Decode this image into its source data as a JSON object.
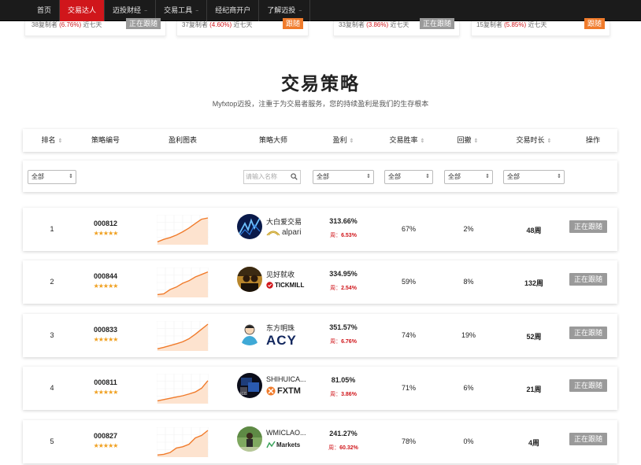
{
  "nav": {
    "items": [
      {
        "label": "首页",
        "caret": false,
        "active": false
      },
      {
        "label": "交易达人",
        "caret": false,
        "active": true
      },
      {
        "label": "迈投财经",
        "caret": true,
        "active": false
      },
      {
        "label": "交易工具",
        "caret": true,
        "active": false
      },
      {
        "label": "经纪商开户",
        "caret": false,
        "active": false
      },
      {
        "label": "了解迈投",
        "caret": true,
        "active": false
      }
    ]
  },
  "top_cards": [
    {
      "copiers": "38复制者",
      "pct": "(6.76%)",
      "period": "近七天",
      "button": "正在跟随",
      "button_style": "gray"
    },
    {
      "copiers": "37复制者",
      "pct": "(4.60%)",
      "period": "近七天",
      "button": "跟随",
      "button_style": "orange"
    },
    {
      "copiers": "33复制者",
      "pct": "(3.86%)",
      "period": "近七天",
      "button": "正在跟随",
      "button_style": "gray"
    },
    {
      "copiers": "15复制者",
      "pct": "(5.85%)",
      "period": "近七天",
      "button": "跟随",
      "button_style": "orange"
    }
  ],
  "section": {
    "title": "交易策略",
    "subtitle": "Myfxtop迈投，注重于为交易者服务，您的持续盈利是我们的生存根本"
  },
  "table": {
    "headers": {
      "rank": "排名",
      "code": "策略编号",
      "chart": "盈利图表",
      "master": "策略大师",
      "profit": "盈利",
      "winrate": "交易胜率",
      "drawdown": "回撤",
      "duration": "交易时长",
      "action": "操作"
    },
    "filters": {
      "all": "全部",
      "arrow": "⇕",
      "search_placeholder": "请输入名称"
    },
    "week_prefix": "周：",
    "rows": [
      {
        "rank": "1",
        "code": "000812",
        "stars": "★★★★★",
        "master": "大白爱交易",
        "broker": "alpari",
        "profit": "313.66%",
        "week": "6.53%",
        "winrate": "67%",
        "drawdown": "2%",
        "duration": "48周",
        "action": "正在跟随",
        "curve": [
          0.05,
          0.15,
          0.22,
          0.32,
          0.45,
          0.6,
          0.78,
          0.95,
          1.0
        ]
      },
      {
        "rank": "2",
        "code": "000844",
        "stars": "★★★★★",
        "master": "见好就收",
        "broker": "TICKMILL",
        "profit": "334.95%",
        "week": "2.54%",
        "winrate": "59%",
        "drawdown": "8%",
        "duration": "132周",
        "action": "正在跟随",
        "curve": [
          0.05,
          0.08,
          0.25,
          0.35,
          0.5,
          0.6,
          0.75,
          0.85,
          0.95
        ]
      },
      {
        "rank": "3",
        "code": "000833",
        "stars": "★★★★★",
        "master": "东方明珠",
        "broker": "ACY",
        "profit": "351.57%",
        "week": "6.76%",
        "winrate": "74%",
        "drawdown": "19%",
        "duration": "52周",
        "action": "正在跟随",
        "curve": [
          0.02,
          0.08,
          0.15,
          0.22,
          0.3,
          0.42,
          0.6,
          0.8,
          1.0
        ]
      },
      {
        "rank": "4",
        "code": "000811",
        "stars": "★★★★★",
        "master": "SHIHUICA...",
        "broker": "FXTM",
        "profit": "81.05%",
        "week": "3.86%",
        "winrate": "71%",
        "drawdown": "6%",
        "duration": "21周",
        "action": "正在跟随",
        "curve": [
          0.05,
          0.1,
          0.15,
          0.2,
          0.25,
          0.32,
          0.4,
          0.55,
          0.85
        ]
      },
      {
        "rank": "5",
        "code": "000827",
        "stars": "★★★★★",
        "master": "WMICLAO...",
        "broker": "Markets",
        "profit": "241.27%",
        "week": "60.32%",
        "winrate": "78%",
        "drawdown": "0%",
        "duration": "4周",
        "action": "正在跟随",
        "curve": [
          0.02,
          0.05,
          0.12,
          0.3,
          0.35,
          0.45,
          0.7,
          0.8,
          1.0
        ]
      }
    ]
  },
  "colors": {
    "accent": "#d0161b",
    "curve": "#f07b2b",
    "curve_fill": "#fde3cf",
    "follow_gray": "#9a9a9a",
    "follow_orange": "#f07b2b",
    "star": "#f0a020"
  }
}
